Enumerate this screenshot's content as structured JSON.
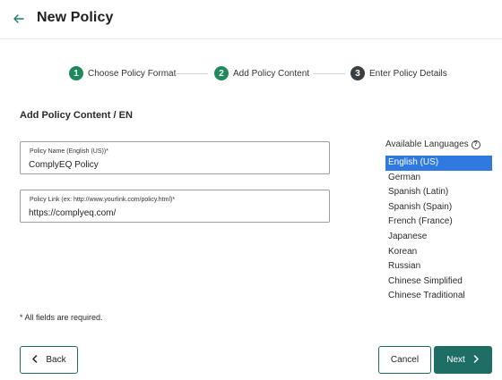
{
  "header": {
    "title": "New Policy"
  },
  "stepper": {
    "steps": [
      {
        "number": "1",
        "label": "Choose Policy Format"
      },
      {
        "number": "2",
        "label": "Add Policy Content"
      },
      {
        "number": "3",
        "label": "Enter Policy Details"
      }
    ]
  },
  "section": {
    "title": "Add Policy Content / EN"
  },
  "fields": {
    "policy_name": {
      "label": "Policy Name (English (US))*",
      "value": "ComplyEQ Policy"
    },
    "policy_link": {
      "label": "Policy Link (ex: http://www.yourlink.com/policy.html)*",
      "value": "https://complyeq.com/"
    }
  },
  "languages": {
    "header": "Available Languages",
    "selected": "English (US)",
    "items": [
      "English (US)",
      "German",
      "Spanish (Latin)",
      "Spanish (Spain)",
      "French (France)",
      "Japanese",
      "Korean",
      "Russian",
      "Chinese Simplified",
      "Chinese Traditional"
    ]
  },
  "required_note": "* All fields are required.",
  "buttons": {
    "back": "Back",
    "cancel": "Cancel",
    "next": "Next"
  },
  "colors": {
    "accent": "#1e6e66",
    "step_done": "#1e8a5c",
    "step_todo": "#3a3f44",
    "selection": "#2f79e0"
  }
}
